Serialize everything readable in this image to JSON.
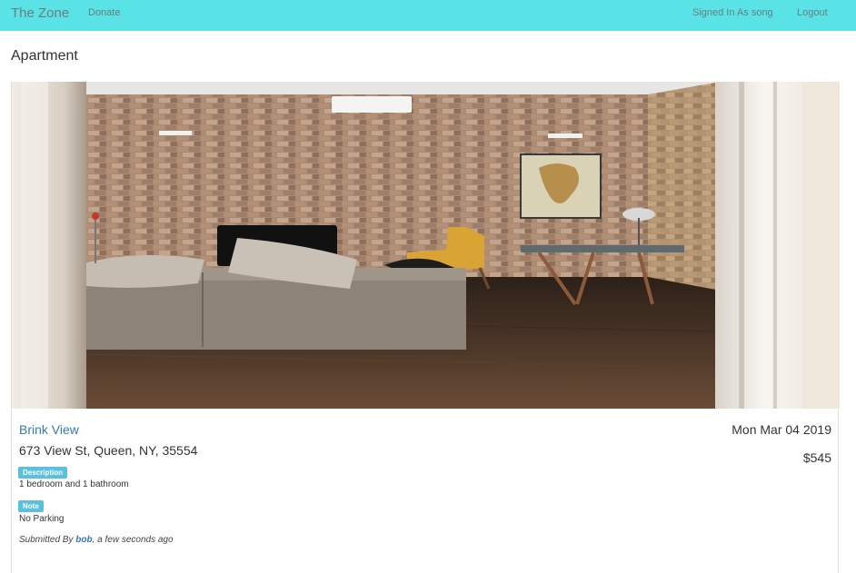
{
  "navbar": {
    "brand": "The Zone",
    "donate": "Donate",
    "signed_in": "Signed In As song",
    "logout": "Logout"
  },
  "page": {
    "title": "Apartment"
  },
  "listing": {
    "title": "Brink View",
    "date": "Mon Mar 04 2019",
    "address": "673 View St, Queen, NY, 35554",
    "price": "$545",
    "description_badge": "Description",
    "description": "1 bedroom and 1 bathroom",
    "note_badge": "Note",
    "note": "No Parking",
    "submitted_prefix": "Submitted By",
    "submitted_user": "bob",
    "submitted_suffix": ", a few seconds ago"
  },
  "colors": {
    "navbar": "#5ae3e6",
    "link": "#337ab7",
    "badge": "#5bc0de"
  }
}
